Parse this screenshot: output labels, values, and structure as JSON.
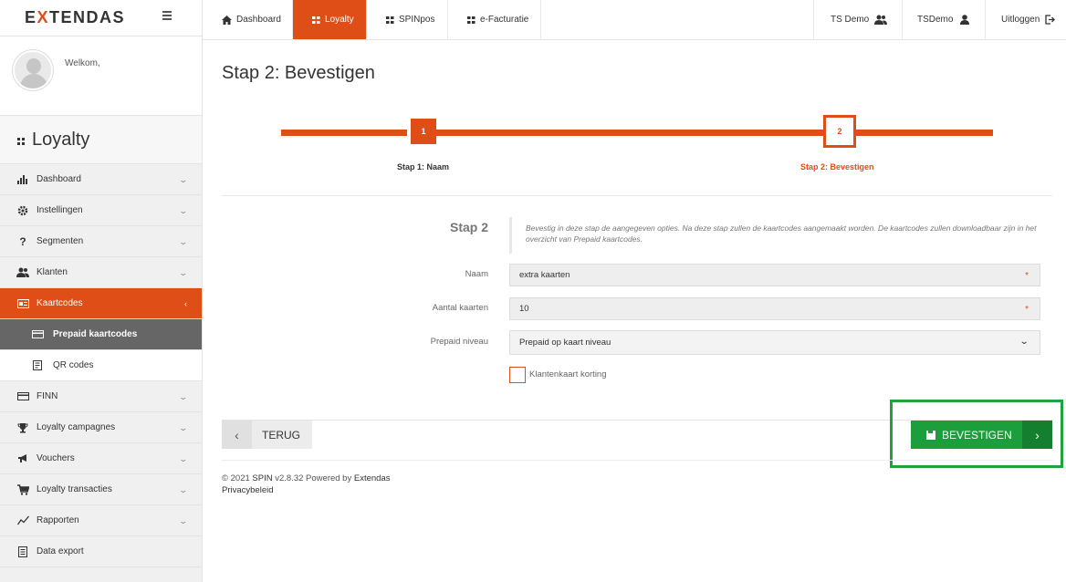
{
  "brand": {
    "logo_prefix": "E",
    "logo_x": "X",
    "logo_rest": "TENDAS",
    "accent": "#e04e18",
    "success": "#1c9e3c"
  },
  "sidebar": {
    "welcome": "Welkom,",
    "module_title": "Loyalty",
    "items": [
      {
        "label": "Dashboard",
        "icon": "bar-chart-icon"
      },
      {
        "label": "Instellingen",
        "icon": "gear-icon"
      },
      {
        "label": "Segmenten",
        "icon": "question-icon"
      },
      {
        "label": "Klanten",
        "icon": "users-icon"
      },
      {
        "label": "Kaartcodes",
        "icon": "card-icon",
        "active": true
      },
      {
        "label": "Prepaid kaartcodes",
        "icon": "credit-card-icon",
        "active": true,
        "sub": true
      },
      {
        "label": "QR codes",
        "icon": "qr-icon",
        "sub": true
      },
      {
        "label": "FINN",
        "icon": "credit-card-icon"
      },
      {
        "label": "Loyalty campagnes",
        "icon": "trophy-icon"
      },
      {
        "label": "Vouchers",
        "icon": "megaphone-icon"
      },
      {
        "label": "Loyalty transacties",
        "icon": "cart-icon"
      },
      {
        "label": "Rapporten",
        "icon": "line-chart-icon"
      },
      {
        "label": "Data export",
        "icon": "document-icon"
      }
    ]
  },
  "topbar": {
    "tabs": [
      {
        "label": "Dashboard",
        "icon": "home-icon"
      },
      {
        "label": "Loyalty",
        "icon": "grid-icon",
        "active": true
      },
      {
        "label": "SPINpos",
        "icon": "grid-icon"
      },
      {
        "label": "e-Facturatie",
        "icon": "grid-icon"
      }
    ],
    "org": "TS Demo",
    "user": "TSDemo",
    "logout": "Uitloggen"
  },
  "page": {
    "title": "Stap 2: Bevestigen",
    "steps": [
      {
        "number": "1",
        "label": "Stap 1: Naam"
      },
      {
        "number": "2",
        "label": "Stap 2: Bevestigen"
      }
    ],
    "step_heading": "Stap 2",
    "step_description": "Bevestig in deze stap de aangegeven opties. Na deze stap zullen de kaartcodes aangemaakt worden. De kaartcodes zullen downloadbaar zijn in het overzicht van Prepaid kaartcodes.",
    "fields": {
      "naam_label": "Naam",
      "naam_value": "extra kaarten",
      "aantal_label": "Aantal kaarten",
      "aantal_value": "10",
      "niveau_label": "Prepaid niveau",
      "niveau_value": "Prepaid op kaart niveau",
      "korting_label": "Klantenkaart korting",
      "korting_checked": false,
      "required_mark": "*"
    },
    "back_label": "TERUG",
    "confirm_label": "BEVESTIGEN"
  },
  "footer": {
    "year": "© 2021",
    "product": "SPIN",
    "version": "v2.8.32 Powered by",
    "company": "Extendas",
    "privacy": "Privacybeleid"
  }
}
